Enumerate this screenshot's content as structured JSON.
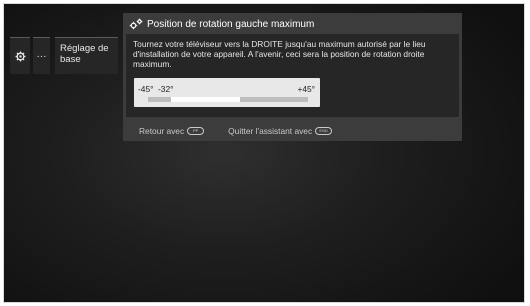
{
  "menu": {
    "dots_label": "···",
    "base_label": "Réglage de base"
  },
  "dialog": {
    "title": "Position de rotation gauche maximum",
    "body": "Tournez votre téléviseur vers la DROITE jusqu'au maximum autorisé par le lieu d'installation de votre appareil. A l'avenir, ceci sera la position de rotation droite maximum.",
    "slider": {
      "min_label": "-45°",
      "current_label": "-32°",
      "max_label": "+45°",
      "min": -45,
      "max": 45,
      "value": -32
    },
    "footer": {
      "back_text": "Retour avec",
      "back_key": "PP",
      "quit_text": "Quitter l'assistant avec",
      "quit_key": "END"
    }
  },
  "icons": {
    "gear": "gear-icon",
    "gears": "gears-icon"
  }
}
